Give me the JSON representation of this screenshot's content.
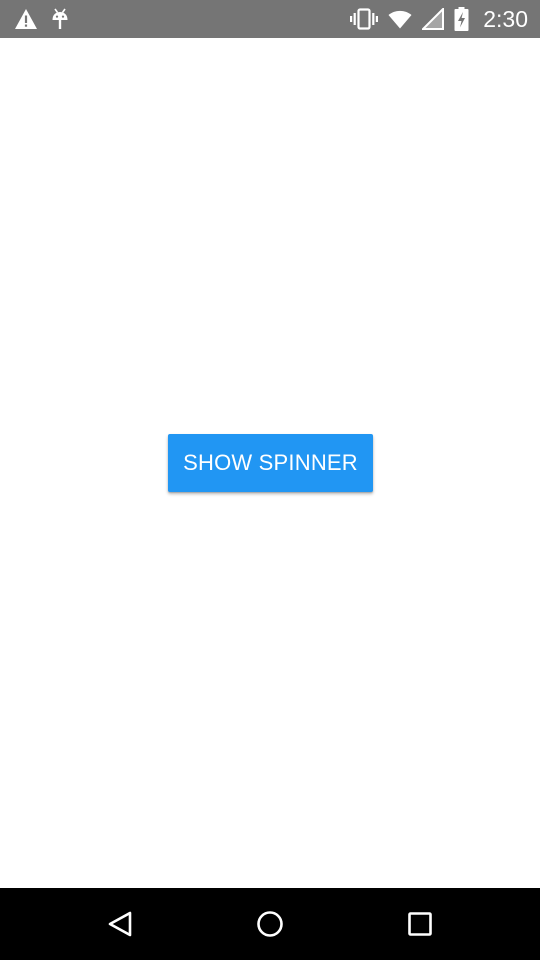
{
  "status_bar": {
    "time": "2:30",
    "icons": [
      "warning-icon",
      "android-debug-icon",
      "vibrate-icon",
      "wifi-icon",
      "signal-icon",
      "battery-charging-icon"
    ],
    "background_color": "#757575"
  },
  "main": {
    "show_spinner_button": "SHOW SPINNER",
    "button_color": "#2196f3"
  },
  "nav_bar": {
    "icons": [
      "back-icon",
      "home-icon",
      "recents-icon"
    ],
    "background_color": "#000000"
  }
}
